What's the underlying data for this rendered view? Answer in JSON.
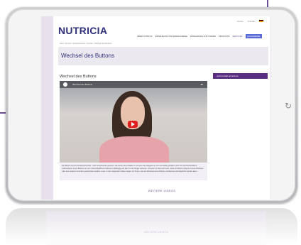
{
  "util": {
    "search_label": "Suche",
    "contact_label": "Kontakt"
  },
  "logo": {
    "text": "NUTRICIA"
  },
  "nav": {
    "items": [
      "ÜBER NUTRICIA",
      "ERNÄHRUNG FÜR ERWACHSENE",
      "ERNÄHRUNG FÜR KINDER",
      "PRODUKTE",
      "SERVICES"
    ],
    "active_label": "FACHKREISE"
  },
  "breadcrumb": {
    "text": "Start › Service › Produktservice › Flocare › Wechsel des Buttons"
  },
  "page": {
    "title": "Wechsel des Buttons",
    "section_title": "Wechsel des Buttons"
  },
  "video": {
    "title": "Wechsel des Buttons",
    "caption": "Der Button ist eine Austauschsonde - auch Knopfsonde genannt, die durch einen Ballon im Inneren des Magens an Ort und Stelle gehalten wird. Die durchschnittliche Lebensdauer eines Buttons ist von unterschiedlichen Faktoren abhängig und kann in der Regel variieren. So kann es dazu kommen, dass ein Button aufgrund eines Defektes oder aus anderen Gründen gewechselt werden muss. In dem folgenden Video zeigen wir Ihnen, wie der Wechsel eines Buttons problemlos durchgeführt werden kann."
  },
  "sidebar": {
    "button_label": "Jetzt Kontakt aufnehmen"
  },
  "footer": {
    "more_videos_label": "WEITERE VIDEOS"
  },
  "reflection": {
    "label": "WEITERE VIDEOS"
  },
  "colors": {
    "brand": "#2d2f7a",
    "accent": "#6a4f93",
    "sidebar_button": "#5a2d82",
    "active_nav": "#5b6bd6"
  }
}
